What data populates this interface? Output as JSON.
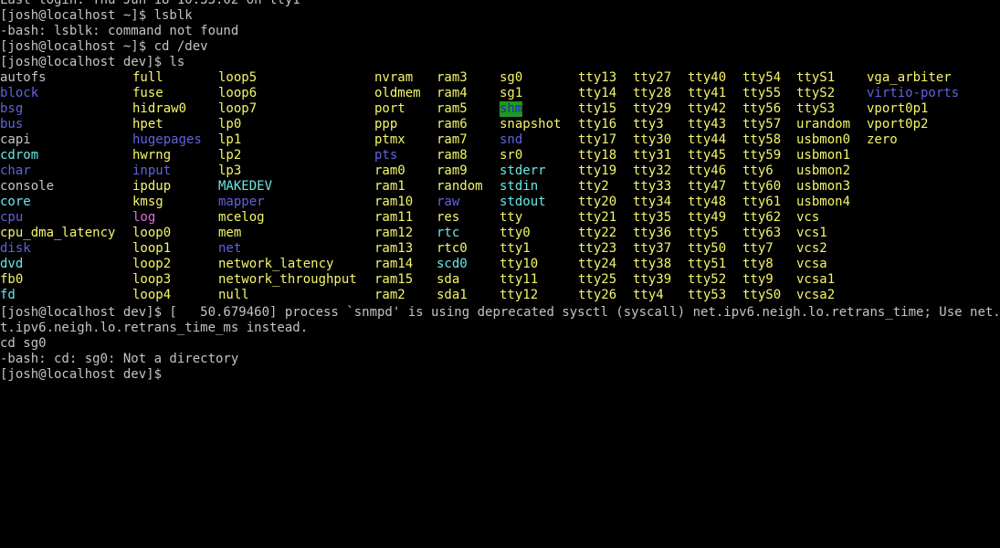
{
  "terminal": {
    "lines_before": [
      "Last login: Thu Jun 18 10:33:02 on tty1",
      "[josh@localhost ~]$ lsblk",
      "-bash: lsblk: command not found",
      "[josh@localhost ~]$ cd /dev",
      "[josh@localhost dev]$ ls"
    ],
    "listing_colors": {
      "white": "#c4c4c4",
      "yellow": "#f5f56a",
      "blue": "#6262e0",
      "magenta": "#e06ae0",
      "cyan": "#6ae6e6",
      "shm_fg": "#2222c8",
      "shm_bg": "#1f9b1f"
    },
    "listing": [
      [
        {
          "t": "autofs",
          "c": "white"
        },
        {
          "t": "full",
          "c": "yellow"
        },
        {
          "t": "loop5",
          "c": "yellow"
        },
        {
          "t": "nvram",
          "c": "yellow"
        },
        {
          "t": "ram3",
          "c": "yellow"
        },
        {
          "t": "sg0",
          "c": "yellow"
        },
        {
          "t": "tty13",
          "c": "yellow"
        },
        {
          "t": "tty27",
          "c": "yellow"
        },
        {
          "t": "tty40",
          "c": "yellow"
        },
        {
          "t": "tty54",
          "c": "yellow"
        },
        {
          "t": "ttyS1",
          "c": "yellow"
        },
        {
          "t": "vga_arbiter",
          "c": "yellow"
        }
      ],
      [
        {
          "t": "block",
          "c": "blue"
        },
        {
          "t": "fuse",
          "c": "yellow"
        },
        {
          "t": "loop6",
          "c": "yellow"
        },
        {
          "t": "oldmem",
          "c": "yellow"
        },
        {
          "t": "ram4",
          "c": "yellow"
        },
        {
          "t": "sg1",
          "c": "yellow"
        },
        {
          "t": "tty14",
          "c": "yellow"
        },
        {
          "t": "tty28",
          "c": "yellow"
        },
        {
          "t": "tty41",
          "c": "yellow"
        },
        {
          "t": "tty55",
          "c": "yellow"
        },
        {
          "t": "ttyS2",
          "c": "yellow"
        },
        {
          "t": "virtio-ports",
          "c": "blue"
        }
      ],
      [
        {
          "t": "bsg",
          "c": "blue"
        },
        {
          "t": "hidraw0",
          "c": "yellow"
        },
        {
          "t": "loop7",
          "c": "yellow"
        },
        {
          "t": "port",
          "c": "yellow"
        },
        {
          "t": "ram5",
          "c": "yellow"
        },
        {
          "t": "shm",
          "c": "shm"
        },
        {
          "t": "tty15",
          "c": "yellow"
        },
        {
          "t": "tty29",
          "c": "yellow"
        },
        {
          "t": "tty42",
          "c": "yellow"
        },
        {
          "t": "tty56",
          "c": "yellow"
        },
        {
          "t": "ttyS3",
          "c": "yellow"
        },
        {
          "t": "vport0p1",
          "c": "yellow"
        }
      ],
      [
        {
          "t": "bus",
          "c": "blue"
        },
        {
          "t": "hpet",
          "c": "yellow"
        },
        {
          "t": "lp0",
          "c": "yellow"
        },
        {
          "t": "ppp",
          "c": "yellow"
        },
        {
          "t": "ram6",
          "c": "yellow"
        },
        {
          "t": "snapshot",
          "c": "yellow"
        },
        {
          "t": "tty16",
          "c": "yellow"
        },
        {
          "t": "tty3",
          "c": "yellow"
        },
        {
          "t": "tty43",
          "c": "yellow"
        },
        {
          "t": "tty57",
          "c": "yellow"
        },
        {
          "t": "urandom",
          "c": "yellow"
        },
        {
          "t": "vport0p2",
          "c": "yellow"
        }
      ],
      [
        {
          "t": "capi",
          "c": "white"
        },
        {
          "t": "hugepages",
          "c": "blue"
        },
        {
          "t": "lp1",
          "c": "yellow"
        },
        {
          "t": "ptmx",
          "c": "yellow"
        },
        {
          "t": "ram7",
          "c": "yellow"
        },
        {
          "t": "snd",
          "c": "blue"
        },
        {
          "t": "tty17",
          "c": "yellow"
        },
        {
          "t": "tty30",
          "c": "yellow"
        },
        {
          "t": "tty44",
          "c": "yellow"
        },
        {
          "t": "tty58",
          "c": "yellow"
        },
        {
          "t": "usbmon0",
          "c": "yellow"
        },
        {
          "t": "zero",
          "c": "yellow"
        }
      ],
      [
        {
          "t": "cdrom",
          "c": "cyan"
        },
        {
          "t": "hwrng",
          "c": "yellow"
        },
        {
          "t": "lp2",
          "c": "yellow"
        },
        {
          "t": "pts",
          "c": "blue"
        },
        {
          "t": "ram8",
          "c": "yellow"
        },
        {
          "t": "sr0",
          "c": "yellow"
        },
        {
          "t": "tty18",
          "c": "yellow"
        },
        {
          "t": "tty31",
          "c": "yellow"
        },
        {
          "t": "tty45",
          "c": "yellow"
        },
        {
          "t": "tty59",
          "c": "yellow"
        },
        {
          "t": "usbmon1",
          "c": "yellow"
        }
      ],
      [
        {
          "t": "char",
          "c": "blue"
        },
        {
          "t": "input",
          "c": "blue"
        },
        {
          "t": "lp3",
          "c": "yellow"
        },
        {
          "t": "ram0",
          "c": "yellow"
        },
        {
          "t": "ram9",
          "c": "yellow"
        },
        {
          "t": "stderr",
          "c": "cyan"
        },
        {
          "t": "tty19",
          "c": "yellow"
        },
        {
          "t": "tty32",
          "c": "yellow"
        },
        {
          "t": "tty46",
          "c": "yellow"
        },
        {
          "t": "tty6",
          "c": "yellow"
        },
        {
          "t": "usbmon2",
          "c": "yellow"
        }
      ],
      [
        {
          "t": "console",
          "c": "white"
        },
        {
          "t": "ipdup",
          "c": "yellow"
        },
        {
          "t": "MAKEDEV",
          "c": "cyan"
        },
        {
          "t": "ram1",
          "c": "yellow"
        },
        {
          "t": "random",
          "c": "yellow"
        },
        {
          "t": "stdin",
          "c": "cyan"
        },
        {
          "t": "tty2",
          "c": "yellow"
        },
        {
          "t": "tty33",
          "c": "yellow"
        },
        {
          "t": "tty47",
          "c": "yellow"
        },
        {
          "t": "tty60",
          "c": "yellow"
        },
        {
          "t": "usbmon3",
          "c": "yellow"
        }
      ],
      [
        {
          "t": "core",
          "c": "cyan"
        },
        {
          "t": "kmsg",
          "c": "yellow"
        },
        {
          "t": "mapper",
          "c": "blue"
        },
        {
          "t": "ram10",
          "c": "yellow"
        },
        {
          "t": "raw",
          "c": "blue"
        },
        {
          "t": "stdout",
          "c": "cyan"
        },
        {
          "t": "tty20",
          "c": "yellow"
        },
        {
          "t": "tty34",
          "c": "yellow"
        },
        {
          "t": "tty48",
          "c": "yellow"
        },
        {
          "t": "tty61",
          "c": "yellow"
        },
        {
          "t": "usbmon4",
          "c": "yellow"
        }
      ],
      [
        {
          "t": "cpu",
          "c": "blue"
        },
        {
          "t": "log",
          "c": "magenta"
        },
        {
          "t": "mcelog",
          "c": "yellow"
        },
        {
          "t": "ram11",
          "c": "yellow"
        },
        {
          "t": "res",
          "c": "yellow"
        },
        {
          "t": "tty",
          "c": "yellow"
        },
        {
          "t": "tty21",
          "c": "yellow"
        },
        {
          "t": "tty35",
          "c": "yellow"
        },
        {
          "t": "tty49",
          "c": "yellow"
        },
        {
          "t": "tty62",
          "c": "yellow"
        },
        {
          "t": "vcs",
          "c": "yellow"
        }
      ],
      [
        {
          "t": "cpu_dma_latency",
          "c": "yellow"
        },
        {
          "t": "loop0",
          "c": "yellow"
        },
        {
          "t": "mem",
          "c": "yellow"
        },
        {
          "t": "ram12",
          "c": "yellow"
        },
        {
          "t": "rtc",
          "c": "cyan"
        },
        {
          "t": "tty0",
          "c": "yellow"
        },
        {
          "t": "tty22",
          "c": "yellow"
        },
        {
          "t": "tty36",
          "c": "yellow"
        },
        {
          "t": "tty5",
          "c": "yellow"
        },
        {
          "t": "tty63",
          "c": "yellow"
        },
        {
          "t": "vcs1",
          "c": "yellow"
        }
      ],
      [
        {
          "t": "disk",
          "c": "blue"
        },
        {
          "t": "loop1",
          "c": "yellow"
        },
        {
          "t": "net",
          "c": "blue"
        },
        {
          "t": "ram13",
          "c": "yellow"
        },
        {
          "t": "rtc0",
          "c": "yellow"
        },
        {
          "t": "tty1",
          "c": "yellow"
        },
        {
          "t": "tty23",
          "c": "yellow"
        },
        {
          "t": "tty37",
          "c": "yellow"
        },
        {
          "t": "tty50",
          "c": "yellow"
        },
        {
          "t": "tty7",
          "c": "yellow"
        },
        {
          "t": "vcs2",
          "c": "yellow"
        }
      ],
      [
        {
          "t": "dvd",
          "c": "cyan"
        },
        {
          "t": "loop2",
          "c": "yellow"
        },
        {
          "t": "network_latency",
          "c": "yellow"
        },
        {
          "t": "ram14",
          "c": "yellow"
        },
        {
          "t": "scd0",
          "c": "cyan"
        },
        {
          "t": "tty10",
          "c": "yellow"
        },
        {
          "t": "tty24",
          "c": "yellow"
        },
        {
          "t": "tty38",
          "c": "yellow"
        },
        {
          "t": "tty51",
          "c": "yellow"
        },
        {
          "t": "tty8",
          "c": "yellow"
        },
        {
          "t": "vcsa",
          "c": "yellow"
        }
      ],
      [
        {
          "t": "fb0",
          "c": "yellow"
        },
        {
          "t": "loop3",
          "c": "yellow"
        },
        {
          "t": "network_throughput",
          "c": "yellow"
        },
        {
          "t": "ram15",
          "c": "yellow"
        },
        {
          "t": "sda",
          "c": "yellow"
        },
        {
          "t": "tty11",
          "c": "yellow"
        },
        {
          "t": "tty25",
          "c": "yellow"
        },
        {
          "t": "tty39",
          "c": "yellow"
        },
        {
          "t": "tty52",
          "c": "yellow"
        },
        {
          "t": "tty9",
          "c": "yellow"
        },
        {
          "t": "vcsa1",
          "c": "yellow"
        }
      ],
      [
        {
          "t": "fd",
          "c": "cyan"
        },
        {
          "t": "loop4",
          "c": "yellow"
        },
        {
          "t": "null",
          "c": "yellow"
        },
        {
          "t": "ram2",
          "c": "yellow"
        },
        {
          "t": "sda1",
          "c": "yellow"
        },
        {
          "t": "tty12",
          "c": "yellow"
        },
        {
          "t": "tty26",
          "c": "yellow"
        },
        {
          "t": "tty4",
          "c": "yellow"
        },
        {
          "t": "tty53",
          "c": "yellow"
        },
        {
          "t": "ttyS0",
          "c": "yellow"
        },
        {
          "t": "vcsa2",
          "c": "yellow"
        }
      ]
    ],
    "lines_after": [
      "[josh@localhost dev]$ [   50.679460] process `snmpd' is using deprecated sysctl (syscall) net.ipv6.neigh.lo.retrans_time; Use net.ipv6.neigh.lo.retrans_time_ms instead.",
      "t.ipv6.neigh.lo.retrans_time_ms instead.",
      "cd sg0",
      "-bash: cd: sg0: Not a directory",
      "[josh@localhost dev]$"
    ]
  }
}
